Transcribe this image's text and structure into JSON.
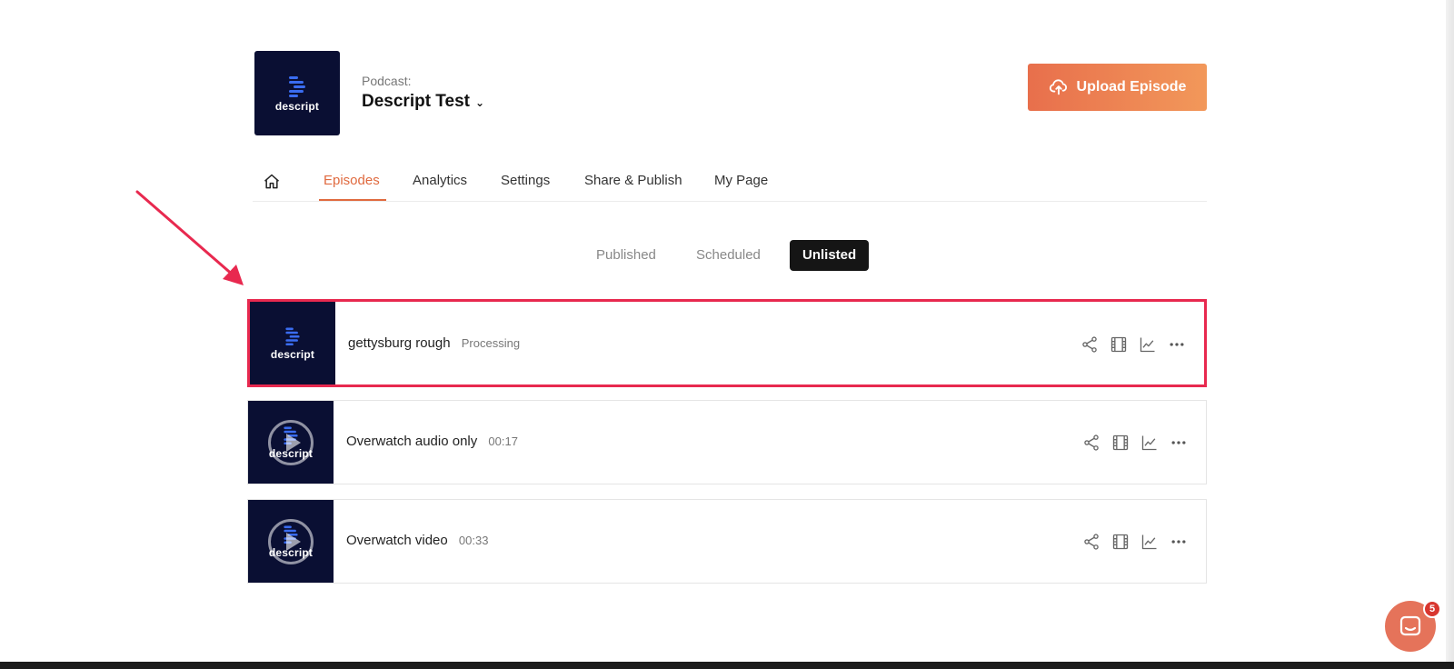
{
  "podcast": {
    "caption": "Podcast:",
    "name": "Descript Test",
    "art_logo_text": "descript"
  },
  "upload_button": {
    "label": "Upload Episode"
  },
  "nav": {
    "tabs": [
      {
        "label": "Episodes",
        "active": true
      },
      {
        "label": "Analytics"
      },
      {
        "label": "Settings"
      },
      {
        "label": "Share & Publish"
      },
      {
        "label": "My Page"
      }
    ]
  },
  "filters": [
    {
      "label": "Published"
    },
    {
      "label": "Scheduled"
    },
    {
      "label": "Unlisted",
      "active": true
    }
  ],
  "episodes": [
    {
      "title": "gettysburg rough",
      "meta": "Processing",
      "thumb_text": "descript",
      "highlighted": true
    },
    {
      "title": "Overwatch audio only",
      "meta": "00:17",
      "thumb_text": "descript"
    },
    {
      "title": "Overwatch video",
      "meta": "00:33",
      "thumb_text": "descript"
    }
  ],
  "chat": {
    "badge_count": "5"
  },
  "colors": {
    "accent": "#e06a3f",
    "highlight": "#e8294f",
    "art_bg": "#0a0f33",
    "logo_blue": "#3a6cf0"
  }
}
